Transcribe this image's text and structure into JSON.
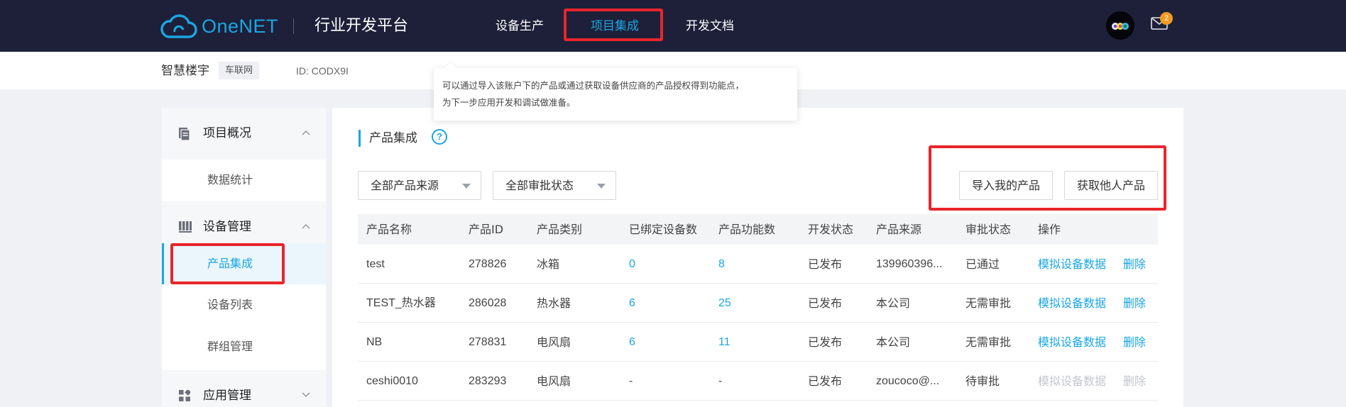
{
  "topbar": {
    "brand": "OneNET",
    "platform_title": "行业开发平台",
    "nav": [
      {
        "label": "设备生产",
        "active": false
      },
      {
        "label": "项目集成",
        "active": true
      },
      {
        "label": "开发文档",
        "active": false
      }
    ],
    "mail_badge": "2",
    "accent_color": "#1aa6e4",
    "highlight_color": "#e9252b"
  },
  "subheader": {
    "project_name": "智慧楼宇",
    "project_tag": "车联网",
    "project_id": "ID: CODX9I"
  },
  "tooltip": {
    "line1": "可以通过导入该账户下的产品或通过获取设备供应商的产品授权得到功能点，",
    "line2": "为下一步应用开发和调试做准备。"
  },
  "sidebar": {
    "groups": [
      {
        "icon": "document-icon",
        "label": "项目概况",
        "items": [
          "数据统计"
        ]
      },
      {
        "icon": "device-icon",
        "label": "设备管理",
        "items": [
          "产品集成",
          "设备列表",
          "群组管理"
        ]
      },
      {
        "icon": "apps-icon",
        "label": "应用管理",
        "items": []
      }
    ],
    "active_item": "产品集成"
  },
  "main": {
    "section_title": "产品集成",
    "help_glyph": "?",
    "filters": {
      "source": "全部产品来源",
      "approval": "全部审批状态"
    },
    "buttons": {
      "import": "导入我的产品",
      "obtain": "获取他人产品"
    },
    "table": {
      "columns": [
        "产品名称",
        "产品ID",
        "产品类别",
        "已绑定设备数",
        "产品功能数",
        "开发状态",
        "产品来源",
        "审批状态",
        "操作"
      ],
      "rows": [
        {
          "name": "test",
          "id": "278826",
          "category": "冰箱",
          "bound": "0",
          "functions": "8",
          "dev_status": "已发布",
          "source": "139960396...",
          "approval": "已通过",
          "action_simulate": "模拟设备数据",
          "action_delete": "删除",
          "actions_enabled": true
        },
        {
          "name": "TEST_热水器",
          "id": "286028",
          "category": "热水器",
          "bound": "6",
          "functions": "25",
          "dev_status": "已发布",
          "source": "本公司",
          "approval": "无需审批",
          "action_simulate": "模拟设备数据",
          "action_delete": "删除",
          "actions_enabled": true
        },
        {
          "name": "NB",
          "id": "278831",
          "category": "电风扇",
          "bound": "6",
          "functions": "11",
          "dev_status": "已发布",
          "source": "本公司",
          "approval": "无需审批",
          "action_simulate": "模拟设备数据",
          "action_delete": "删除",
          "actions_enabled": true
        },
        {
          "name": "ceshi0010",
          "id": "283293",
          "category": "电风扇",
          "bound": "-",
          "functions": "-",
          "dev_status": "已发布",
          "source": "zoucoco@...",
          "approval": "待审批",
          "action_simulate": "模拟设备数据",
          "action_delete": "删除",
          "actions_enabled": false
        }
      ]
    }
  }
}
